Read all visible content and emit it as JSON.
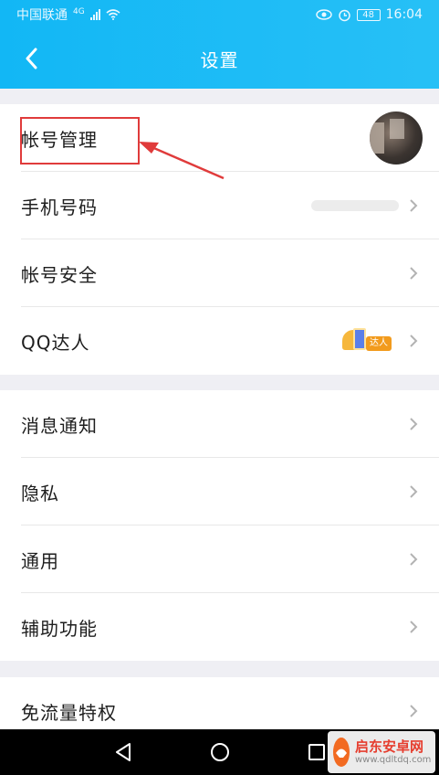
{
  "status": {
    "carrier": "中国联通",
    "network": "4G",
    "battery": "48",
    "time": "16:04"
  },
  "nav": {
    "title": "设置"
  },
  "groups": [
    {
      "items": [
        {
          "label": "帐号管理"
        },
        {
          "label": "手机号码"
        },
        {
          "label": "帐号安全"
        },
        {
          "label": "QQ达人",
          "badge_text": "达人"
        }
      ]
    },
    {
      "items": [
        {
          "label": "消息通知"
        },
        {
          "label": "隐私"
        },
        {
          "label": "通用"
        },
        {
          "label": "辅助功能"
        }
      ]
    },
    {
      "items": [
        {
          "label": "免流量特权"
        }
      ]
    }
  ],
  "watermark": {
    "name": "启东安卓网",
    "url": "www.qdltdq.com"
  },
  "colors": {
    "header": "#12b7f5",
    "highlight": "#e03b3b",
    "background": "#efeff4"
  }
}
